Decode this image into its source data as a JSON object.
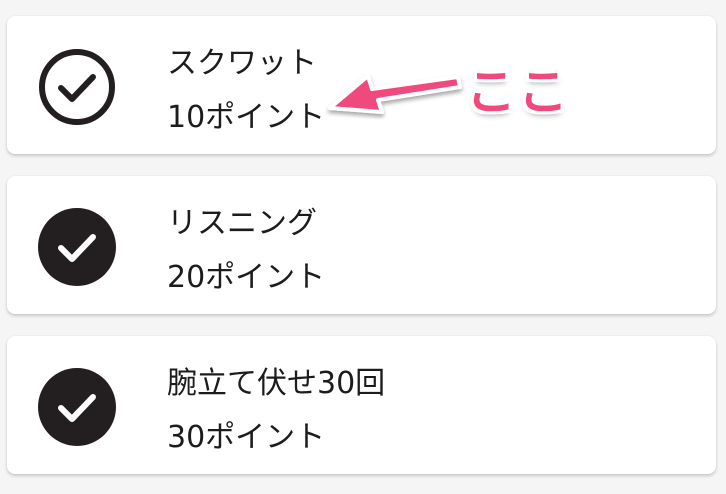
{
  "tasks": [
    {
      "title": "スクワット",
      "points": "10ポイント",
      "status": "outline"
    },
    {
      "title": "リスニング",
      "points": "20ポイント",
      "status": "filled"
    },
    {
      "title": "腕立て伏せ30回",
      "points": "30ポイント",
      "status": "filled"
    }
  ],
  "annotation": {
    "text": "ここ",
    "color": "#ef4a7e"
  },
  "icons": {
    "check": "check-circle-icon"
  }
}
